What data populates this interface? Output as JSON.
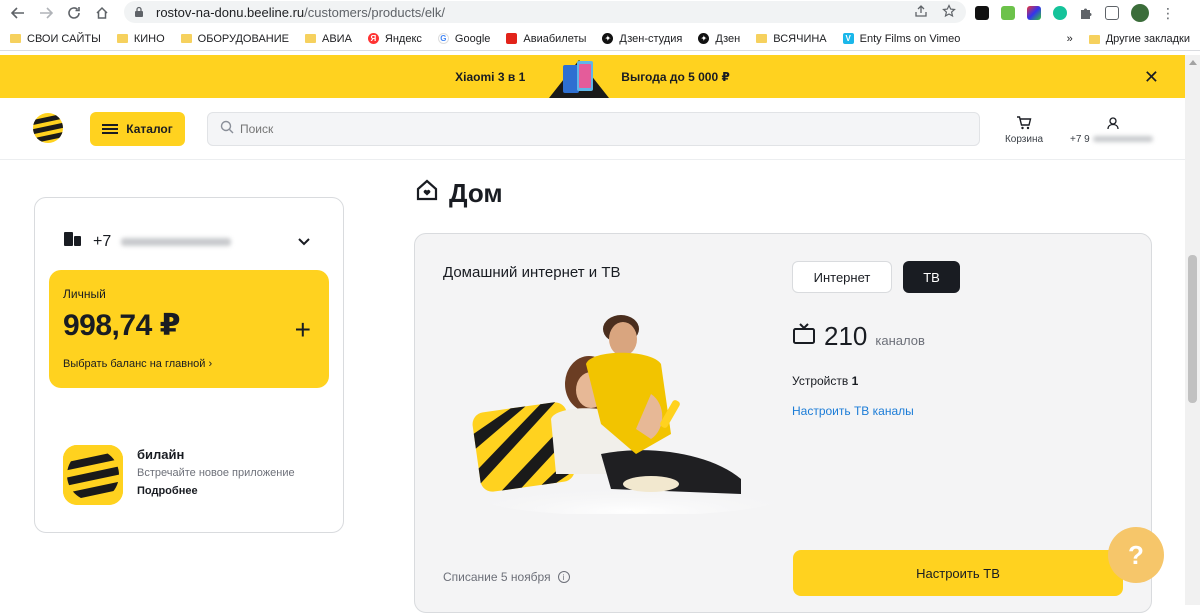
{
  "browser": {
    "url_host": "rostov-na-donu.beeline.ru",
    "url_path": "/customers/products/elk/",
    "bookmarks": [
      {
        "label": "СВОИ САЙТЫ",
        "icon": "folder-icon"
      },
      {
        "label": "КИНО",
        "icon": "folder-icon"
      },
      {
        "label": "ОБОРУДОВАНИЕ",
        "icon": "folder-icon"
      },
      {
        "label": "АВИА",
        "icon": "folder-icon"
      },
      {
        "label": "Яндекс",
        "icon": "yandex-icon"
      },
      {
        "label": "Google",
        "icon": "google-icon"
      },
      {
        "label": "Авиабилеты",
        "icon": "tickets-icon"
      },
      {
        "label": "Дзен-студия",
        "icon": "zen-icon"
      },
      {
        "label": "Дзен",
        "icon": "zen-icon"
      },
      {
        "label": "ВСЯЧИНА",
        "icon": "folder-icon"
      },
      {
        "label": "Enty Films on Vimeo",
        "icon": "vimeo-icon"
      }
    ],
    "more_bookmarks": "»",
    "other_bookmarks": "Другие закладки"
  },
  "promo": {
    "brand": "Xiaomi",
    "offer": "3 в 1",
    "discount": "Выгода до 5 000 ₽",
    "close": "✕"
  },
  "header": {
    "catalog_label": "Каталог",
    "search_placeholder": "Поиск",
    "cart_label": "Корзина",
    "account_phone": "+7 9"
  },
  "account_card": {
    "phone_prefix": "+7",
    "balance_label": "Личный",
    "balance_amount": "998,74 ₽",
    "add_label": "+",
    "choose_balance_link": "Выбрать баланс на главной",
    "app_name": "билайн",
    "app_desc": "Встречайте новое приложение",
    "app_more": "Подробнее"
  },
  "main": {
    "page_title": "Дом",
    "card_title": "Домашний интернет и ТВ",
    "tabs": [
      {
        "label": "Интернет",
        "active": false
      },
      {
        "label": "ТВ",
        "active": true
      }
    ],
    "channels_count": "210",
    "channels_unit": "каналов",
    "devices_label": "Устройств",
    "devices_count": "1",
    "tune_channels_link": "Настроить ТВ каналы",
    "charge_text": "Списание 5 ноября",
    "tune_tv_button": "Настроить ТВ",
    "help_label": "?"
  },
  "colors": {
    "brand_yellow": "#ffd21f",
    "dark": "#191c22",
    "link_blue": "#1b7cd7",
    "help_orange": "#f6c66a"
  }
}
